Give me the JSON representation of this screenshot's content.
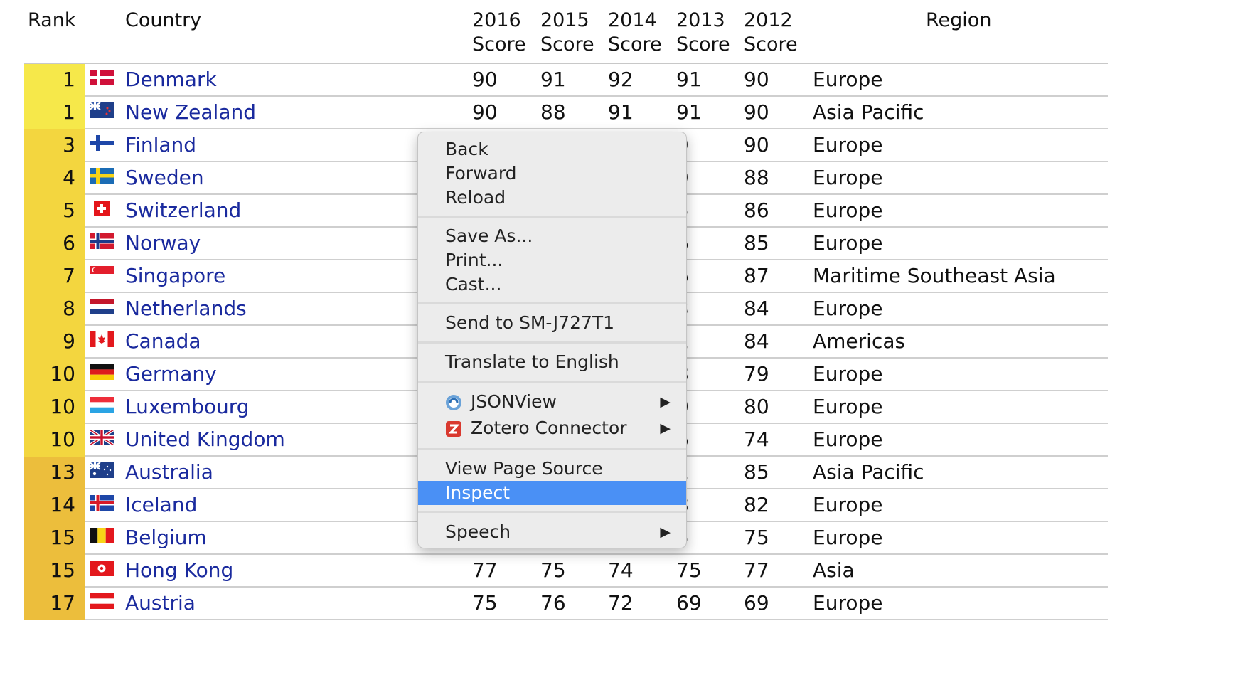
{
  "headers": {
    "rank": "Rank",
    "country": "Country",
    "years": [
      {
        "line1": "2016",
        "line2": "Score"
      },
      {
        "line1": "2015",
        "line2": "Score"
      },
      {
        "line1": "2014",
        "line2": "Score"
      },
      {
        "line1": "2013",
        "line2": "Score"
      },
      {
        "line1": "2012",
        "line2": "Score"
      }
    ],
    "region": "Region"
  },
  "rows": [
    {
      "rank": "1",
      "flag": "denmark-flag-icon",
      "country": "Denmark",
      "scores": [
        "90",
        "91",
        "92",
        "91",
        "90"
      ],
      "region": "Europe",
      "rank_color": "#f6e84a"
    },
    {
      "rank": "1",
      "flag": "new-zealand-flag-icon",
      "country": "New Zealand",
      "scores": [
        "90",
        "88",
        "91",
        "91",
        "90"
      ],
      "region": "Asia Pacific",
      "rank_color": "#f6e84a"
    },
    {
      "rank": "3",
      "flag": "finland-flag-icon",
      "country": "Finland",
      "scores": [
        "",
        "",
        "",
        "9",
        "90"
      ],
      "region": "Europe",
      "rank_color": "#f3d63f"
    },
    {
      "rank": "4",
      "flag": "sweden-flag-icon",
      "country": "Sweden",
      "scores": [
        "",
        "",
        "",
        "9",
        "88"
      ],
      "region": "Europe",
      "rank_color": "#f3d63f"
    },
    {
      "rank": "5",
      "flag": "switzerland-flag-icon",
      "country": "Switzerland",
      "scores": [
        "",
        "",
        "",
        "5",
        "86"
      ],
      "region": "Europe",
      "rank_color": "#f3d63f"
    },
    {
      "rank": "6",
      "flag": "norway-flag-icon",
      "country": "Norway",
      "scores": [
        "",
        "",
        "",
        "6",
        "85"
      ],
      "region": "Europe",
      "rank_color": "#f3d63f"
    },
    {
      "rank": "7",
      "flag": "singapore-flag-icon",
      "country": "Singapore",
      "scores": [
        "",
        "",
        "",
        "6",
        "87"
      ],
      "region": "Maritime Southeast Asia",
      "rank_color": "#f3d63f"
    },
    {
      "rank": "8",
      "flag": "netherlands-flag-icon",
      "country": "Netherlands",
      "scores": [
        "",
        "",
        "",
        "3",
        "84"
      ],
      "region": "Europe",
      "rank_color": "#f3d63f"
    },
    {
      "rank": "9",
      "flag": "canada-flag-icon",
      "country": "Canada",
      "scores": [
        "",
        "",
        "",
        "1",
        "84"
      ],
      "region": "Americas",
      "rank_color": "#f3d63f"
    },
    {
      "rank": "10",
      "flag": "germany-flag-icon",
      "country": "Germany",
      "scores": [
        "",
        "",
        "",
        "8",
        "79"
      ],
      "region": "Europe",
      "rank_color": "#f3d63f"
    },
    {
      "rank": "10",
      "flag": "luxembourg-flag-icon",
      "country": "Luxembourg",
      "scores": [
        "",
        "",
        "",
        "0",
        "80"
      ],
      "region": "Europe",
      "rank_color": "#f3d63f"
    },
    {
      "rank": "10",
      "flag": "united-kingdom-flag-icon",
      "country": "United Kingdom",
      "scores": [
        "",
        "",
        "",
        "6",
        "74"
      ],
      "region": "Europe",
      "rank_color": "#f3d63f"
    },
    {
      "rank": "13",
      "flag": "australia-flag-icon",
      "country": "Australia",
      "scores": [
        "",
        "",
        "",
        "1",
        "85"
      ],
      "region": "Asia Pacific",
      "rank_color": "#ecbe3c"
    },
    {
      "rank": "14",
      "flag": "iceland-flag-icon",
      "country": "Iceland",
      "scores": [
        "",
        "",
        "",
        "8",
        "82"
      ],
      "region": "Europe",
      "rank_color": "#ecbe3c"
    },
    {
      "rank": "15",
      "flag": "belgium-flag-icon",
      "country": "Belgium",
      "scores": [
        "",
        "",
        "",
        "5",
        "75"
      ],
      "region": "Europe",
      "rank_color": "#ecbe3c"
    },
    {
      "rank": "15",
      "flag": "hong-kong-flag-icon",
      "country": "Hong Kong",
      "scores": [
        "77",
        "75",
        "74",
        "75",
        "77"
      ],
      "region": "Asia",
      "rank_color": "#ecbe3c"
    },
    {
      "rank": "17",
      "flag": "austria-flag-icon",
      "country": "Austria",
      "scores": [
        "75",
        "76",
        "72",
        "69",
        "69"
      ],
      "region": "Europe",
      "rank_color": "#ecbe3c"
    }
  ],
  "context_menu": {
    "back": "Back",
    "forward": "Forward",
    "reload": "Reload",
    "save_as": "Save As...",
    "print": "Print...",
    "cast": "Cast...",
    "send_to": "Send to SM-J727T1",
    "translate": "Translate to English",
    "jsonview": "JSONView",
    "zotero": "Zotero Connector",
    "view_source": "View Page Source",
    "inspect": "Inspect",
    "speech": "Speech",
    "submenu_arrow": "▶",
    "highlight_color": "#4a90f5"
  }
}
